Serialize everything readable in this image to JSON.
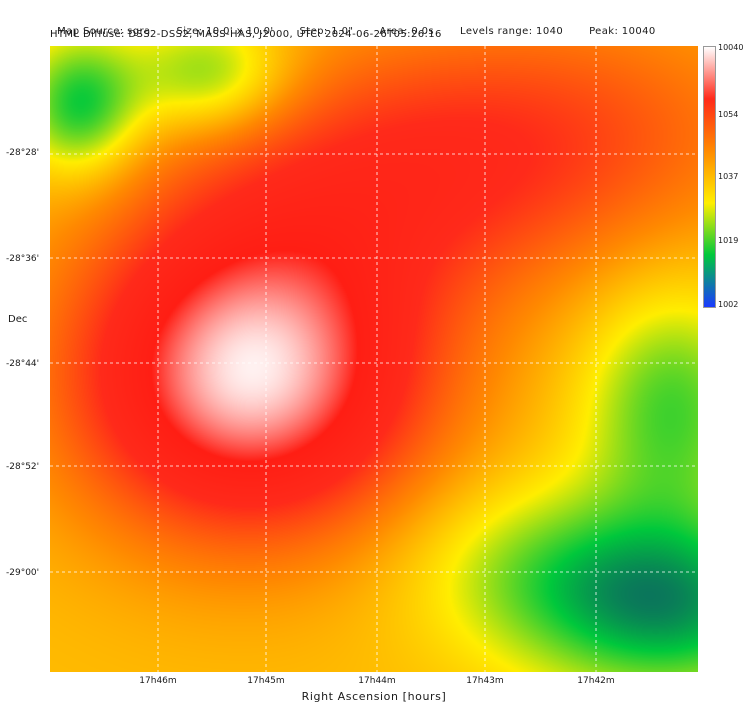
{
  "header": {
    "line1": [
      "Map Source: sgra",
      "Size: 10.0' x 10.0'",
      "Step: 1.0\"",
      "Area: 0.0s",
      "Levels range: 1040",
      "Peak: 10040"
    ],
    "line2": "HTML Diffuse: DSS2-DSS2, MASS-HAS, J2000, UTC: 2024-06-26T05:26:16"
  },
  "axes": {
    "xlabel": "Right Ascension [hours]",
    "ylabel": "Dec",
    "xticks": [
      "17h46m",
      "17h45m",
      "17h44m",
      "17h43m",
      "17h42m"
    ],
    "yticks": [
      "-28°28'",
      "-28°36'",
      "-28°44'",
      "-28°52'",
      "-29°00'"
    ]
  },
  "colorbar": {
    "ticks": [
      "10040",
      "1054",
      "1037",
      "1019",
      "1002"
    ],
    "colors": [
      "#ffffff",
      "#ff2a1a",
      "#ff8a00",
      "#ffee00",
      "#00c83c",
      "#1a3aff"
    ]
  },
  "chart_data": {
    "type": "heatmap",
    "xlabel": "Right Ascension [hours]",
    "ylabel": "Dec",
    "grid": true,
    "colormap_range": [
      1002,
      10040
    ],
    "hotspot": {
      "description": "white peak",
      "level": 10040
    }
  }
}
